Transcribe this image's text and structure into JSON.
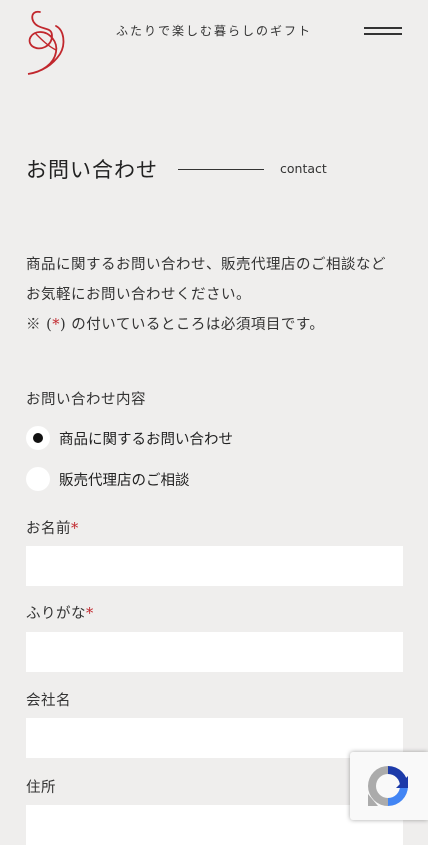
{
  "header": {
    "tagline": "ふたりで楽しむ暮らしのギフト",
    "menu_icon": "hamburger-menu-icon",
    "logo_icon": "ampersand-logo-icon",
    "accent_color": "#c1272d"
  },
  "page": {
    "title": "お問い合わせ",
    "title_en": "contact"
  },
  "intro": {
    "line1": "商品に関するお問い合わせ、販売代理店のご相談など",
    "line2": "お気軽にお問い合わせください。",
    "line3_prefix": "※ (",
    "line3_mark": "*",
    "line3_suffix": ") の付いているところは必須項目です。"
  },
  "form": {
    "inquiry_type_label": "お問い合わせ内容",
    "inquiry_options": [
      {
        "label": "商品に関するお問い合わせ",
        "selected": true
      },
      {
        "label": "販売代理店のご相談",
        "selected": false
      }
    ],
    "required_mark": "*",
    "name_label": "お名前",
    "name_value": "",
    "kana_label": "ふりがな",
    "kana_value": "",
    "company_label": "会社名",
    "company_value": "",
    "address_label": "住所",
    "address_value": ""
  },
  "recaptcha": {
    "icon": "recaptcha-icon"
  }
}
